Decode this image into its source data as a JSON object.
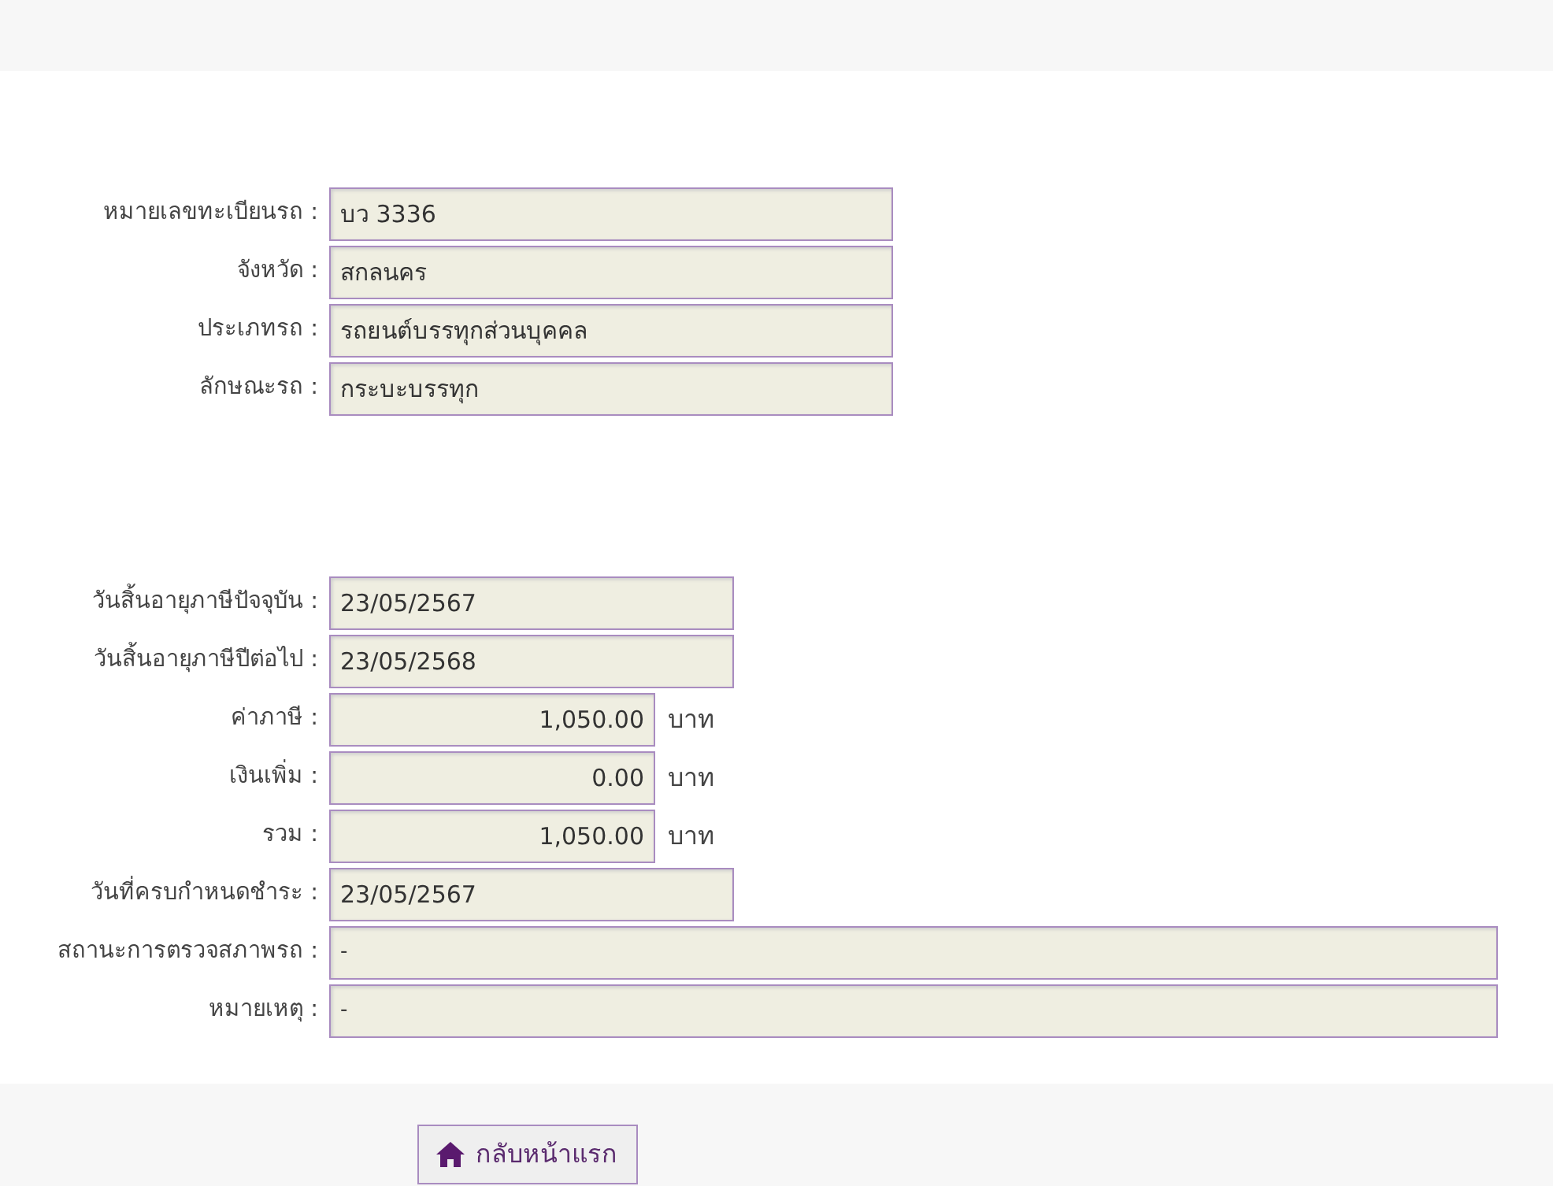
{
  "sections": [
    {
      "fields": [
        {
          "label": "หมายเลขทะเบียนรถ :",
          "value": "บว 3336",
          "kind": "medium"
        },
        {
          "label": "จังหวัด :",
          "value": "สกลนคร",
          "kind": "medium"
        },
        {
          "label": "ประเภทรถ :",
          "value": "รถยนต์บรรทุกส่วนบุคคล",
          "kind": "medium"
        },
        {
          "label": "ลักษณะรถ :",
          "value": "กระบะบรรทุก",
          "kind": "medium"
        }
      ]
    },
    {
      "fields": [
        {
          "label": "วันสิ้นอายุภาษีปัจจุบัน :",
          "value": "23/05/2567",
          "kind": "date"
        },
        {
          "label": "วันสิ้นอายุภาษีปีต่อไป :",
          "value": "23/05/2568",
          "kind": "date"
        },
        {
          "label": "ค่าภาษี :",
          "value": "1,050.00",
          "kind": "amount",
          "unit": "บาท"
        },
        {
          "label": "เงินเพิ่ม :",
          "value": "0.00",
          "kind": "amount",
          "unit": "บาท"
        },
        {
          "label": "รวม :",
          "value": "1,050.00",
          "kind": "amount",
          "unit": "บาท"
        },
        {
          "label": "วันที่ครบกำหนดชำระ :",
          "value": "23/05/2567",
          "kind": "date"
        },
        {
          "label": "สถานะการตรวจสภาพรถ :",
          "value": "-",
          "kind": "wide"
        },
        {
          "label": "หมายเหตุ :",
          "value": "-",
          "kind": "wide"
        }
      ]
    }
  ],
  "home_button": {
    "label": "กลับหน้าแรก"
  }
}
